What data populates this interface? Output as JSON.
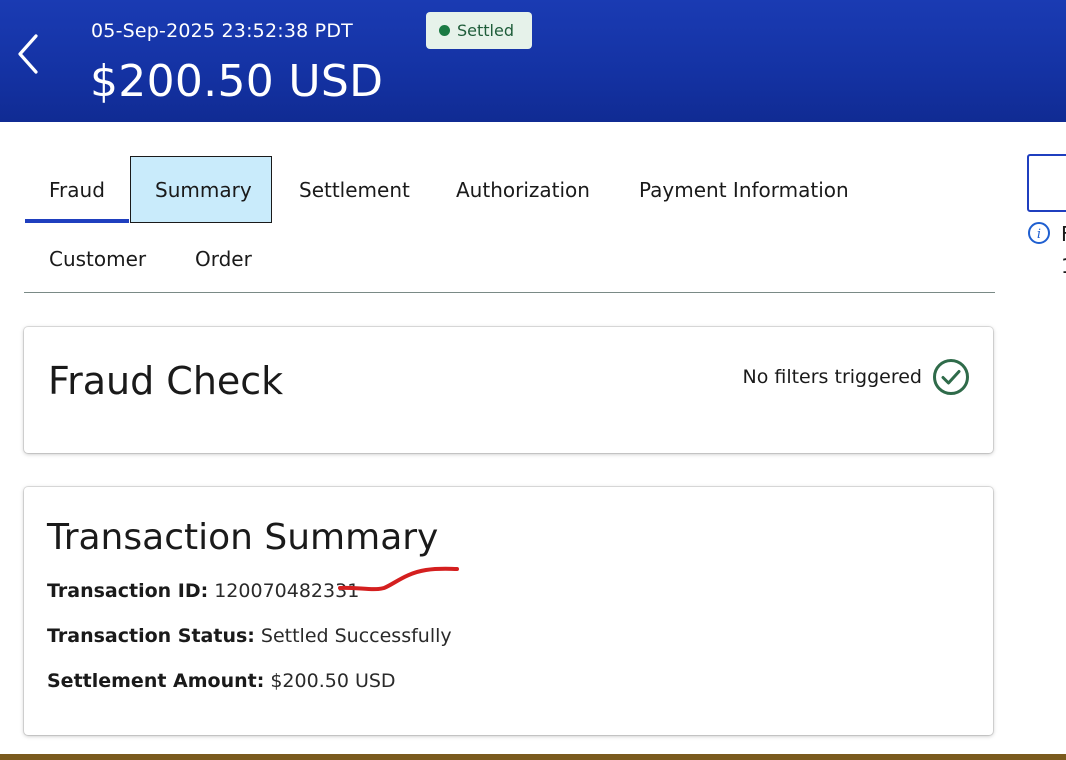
{
  "header": {
    "datetime": "05-Sep-2025 23:52:38 PDT",
    "amount": "$200.50 USD",
    "status": "Settled",
    "back_icon": "chevron-left-icon"
  },
  "tabs": [
    {
      "label": "Fraud",
      "active": true
    },
    {
      "label": "Summary",
      "highlighted": true
    },
    {
      "label": "Settlement"
    },
    {
      "label": "Authorization"
    },
    {
      "label": "Payment Information"
    },
    {
      "label": "Customer"
    },
    {
      "label": "Order"
    }
  ],
  "side_panel": {
    "info_icon": "info-icon",
    "line1": "F",
    "line2": "1"
  },
  "fraud_check": {
    "title": "Fraud Check",
    "status_text": "No filters triggered",
    "status_icon": "check-circle-icon"
  },
  "transaction_summary": {
    "title": "Transaction Summary",
    "rows": [
      {
        "label": "Transaction ID:",
        "value": "120070482331"
      },
      {
        "label": "Transaction Status:",
        "value": "Settled Successfully"
      },
      {
        "label": "Settlement Amount:",
        "value": "$200.50 USD"
      }
    ]
  },
  "colors": {
    "header_bg": "#1432a3",
    "tab_active_underline": "#1f3fbf",
    "tab_highlight_bg": "#c9ebfb",
    "status_badge_bg": "#e6f2ea",
    "status_dot": "#1a7a43",
    "check_icon": "#2f6b4a",
    "annotation_mark": "#d41f1f"
  }
}
